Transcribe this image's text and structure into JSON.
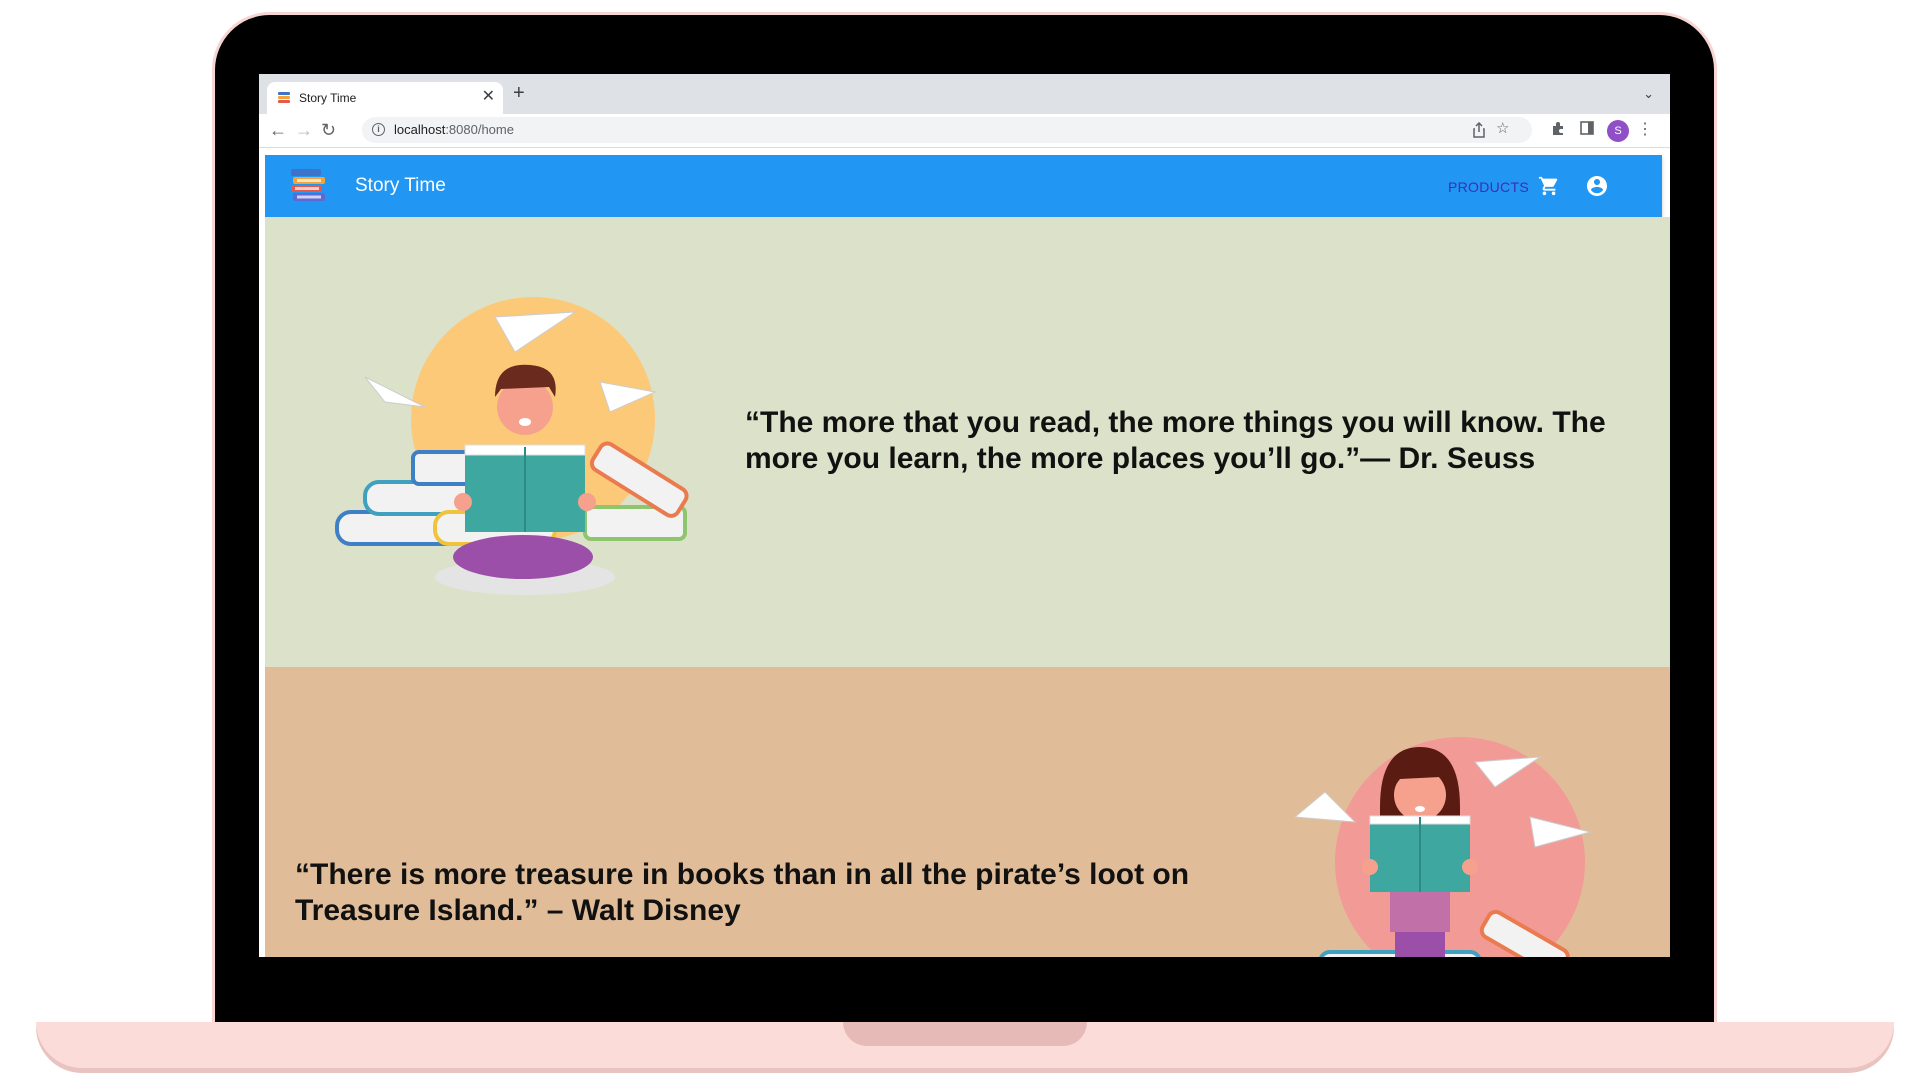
{
  "browser": {
    "tab_title": "Story Time",
    "tab_close": "✕",
    "new_tab": "+",
    "tabs_menu": "⌄",
    "url_host": "localhost",
    "url_path": ":8080/home",
    "profile_initial": "S"
  },
  "app": {
    "title": "Story Time",
    "nav": {
      "products_label": "PRODUCTS"
    },
    "colors": {
      "appbar": "#2196f3",
      "section1_bg": "#dce1c9",
      "section2_bg": "#e0bd98"
    }
  },
  "sections": [
    {
      "quote": "“The more that you read, the more things you will know. The more you learn, the more places you’ll go.”— Dr. Seuss"
    },
    {
      "quote": "“There is more treasure in books than in all the pirate’s loot on Treasure Island.” – Walt Disney"
    }
  ]
}
